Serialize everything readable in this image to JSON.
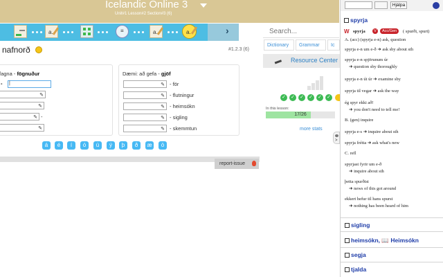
{
  "header": {
    "title": "Icelandic Online 3",
    "subtitle": "Unit#1 Lesson#2 Section#3 (6)"
  },
  "exercise": {
    "heading": "nafnorð",
    "id": "#1.2.3 (6)",
    "left_box": {
      "example_prefix": "fagna - ",
      "example_answer": "fögnuður",
      "rows": [
        {
          "label": ""
        },
        {
          "label": ""
        },
        {
          "label": "-"
        },
        {
          "label": "-"
        },
        {
          "label": ""
        }
      ]
    },
    "right_box": {
      "example_prefix": "Dæmi: að gefa - ",
      "example_answer": "gjöf",
      "rows": [
        {
          "label": "- för"
        },
        {
          "label": "- flutningur"
        },
        {
          "label": "- heimsókn"
        },
        {
          "label": "- sigling"
        },
        {
          "label": "- skemmtun"
        }
      ]
    },
    "special_chars": [
      "á",
      "é",
      "í",
      "ó",
      "ú",
      "ý",
      "þ",
      "ð",
      "æ",
      "ö"
    ],
    "report_label": "report-issue"
  },
  "sidebar": {
    "search_placeholder": "Search...",
    "tabs": [
      "Dictionary",
      "Grammar",
      "Ic"
    ],
    "resource_label": "Resource Center",
    "lesson_label": "In this lesson:",
    "progress_text": "17/26",
    "progress_fraction": 0.654,
    "checks": [
      "✓",
      "✓",
      "✓",
      "✓",
      "✓",
      "✓",
      "✓"
    ],
    "more_stats": "more stats"
  },
  "popup": {
    "help_label": "Hjálpa",
    "entry_title": "spyrja",
    "head_word": "spyrja",
    "v_badge": "V",
    "case_badge": "Acc/Gen",
    "forms": "( spurði, spurt)",
    "lines": [
      {
        "text": "A. (acc) (spyrja e-n) ask, question",
        "indent": false
      },
      {
        "text": "spyrja e-n um e-ð  ➜  ask sby about sth",
        "indent": false
      },
      {
        "text": "spyrja e-n spjörunum úr",
        "indent": false
      },
      {
        "text": "➜  question sby thoroughly",
        "indent": true
      },
      {
        "text": "spyrja e-n út úr  ➜  examine sby",
        "indent": false
      },
      {
        "text": "spyrja til vegar  ➜  ask the way",
        "indent": false
      },
      {
        "text": "ég spyr ekki að!",
        "indent": false
      },
      {
        "text": "➜  you don't need to tell me!",
        "indent": true
      },
      {
        "text": "B. (gen) inquire",
        "indent": false
      },
      {
        "text": "spyrja e-s  ➜  inquire about sth",
        "indent": false
      },
      {
        "text": "spyrja frétta  ➜  ask what's new",
        "indent": false
      },
      {
        "text": "C. refl",
        "indent": false
      },
      {
        "text": "spyrjast fyrir um e-ð",
        "indent": false
      },
      {
        "text": "➜  inquire about sth",
        "indent": true
      },
      {
        "text": "þetta spurðist",
        "indent": false
      },
      {
        "text": "➜  news of this got around",
        "indent": true
      },
      {
        "text": "ekkert hefur til hans spurst",
        "indent": false
      },
      {
        "text": "➜  nothing has been heard of him",
        "indent": true
      }
    ],
    "related": [
      "sigling",
      "heimsókn, 📖 Heimsókn",
      "segja",
      "tjalda"
    ]
  }
}
